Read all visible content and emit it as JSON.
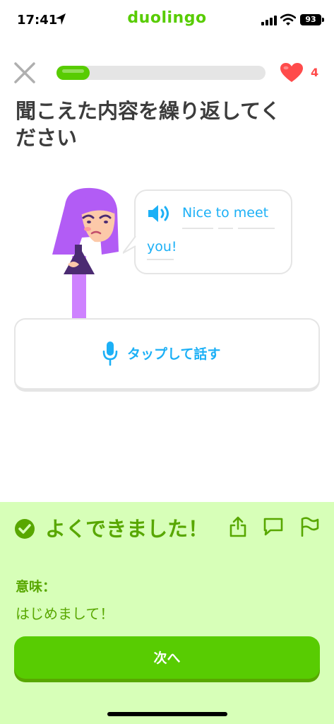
{
  "status_bar": {
    "time": "17:41",
    "battery": "93"
  },
  "app": {
    "brand": "duolingo"
  },
  "lesson": {
    "progress": 0.16,
    "hearts": "4"
  },
  "prompt": {
    "title": "聞こえた内容を繰り返してください"
  },
  "bubble": {
    "line1": "Nice to meet",
    "line2": "you!"
  },
  "speak": {
    "label": "タップして話す"
  },
  "feedback": {
    "title": "よくできました！",
    "meaning_label": "意味：",
    "meaning_text": "はじめまして！",
    "next_label": "次へ"
  },
  "colors": {
    "brand_green": "#58cc02",
    "feedback_bg": "#d7ffb8",
    "feedback_text": "#58a700",
    "accent_blue": "#1cb0f6",
    "heart_red": "#ff4b4b"
  },
  "icons": [
    "location-arrow-icon",
    "signal-icon",
    "wifi-icon",
    "battery-icon",
    "close-icon",
    "heart-icon",
    "speaker-icon",
    "microphone-icon",
    "check-circle-icon",
    "share-icon",
    "comment-icon",
    "flag-icon"
  ]
}
